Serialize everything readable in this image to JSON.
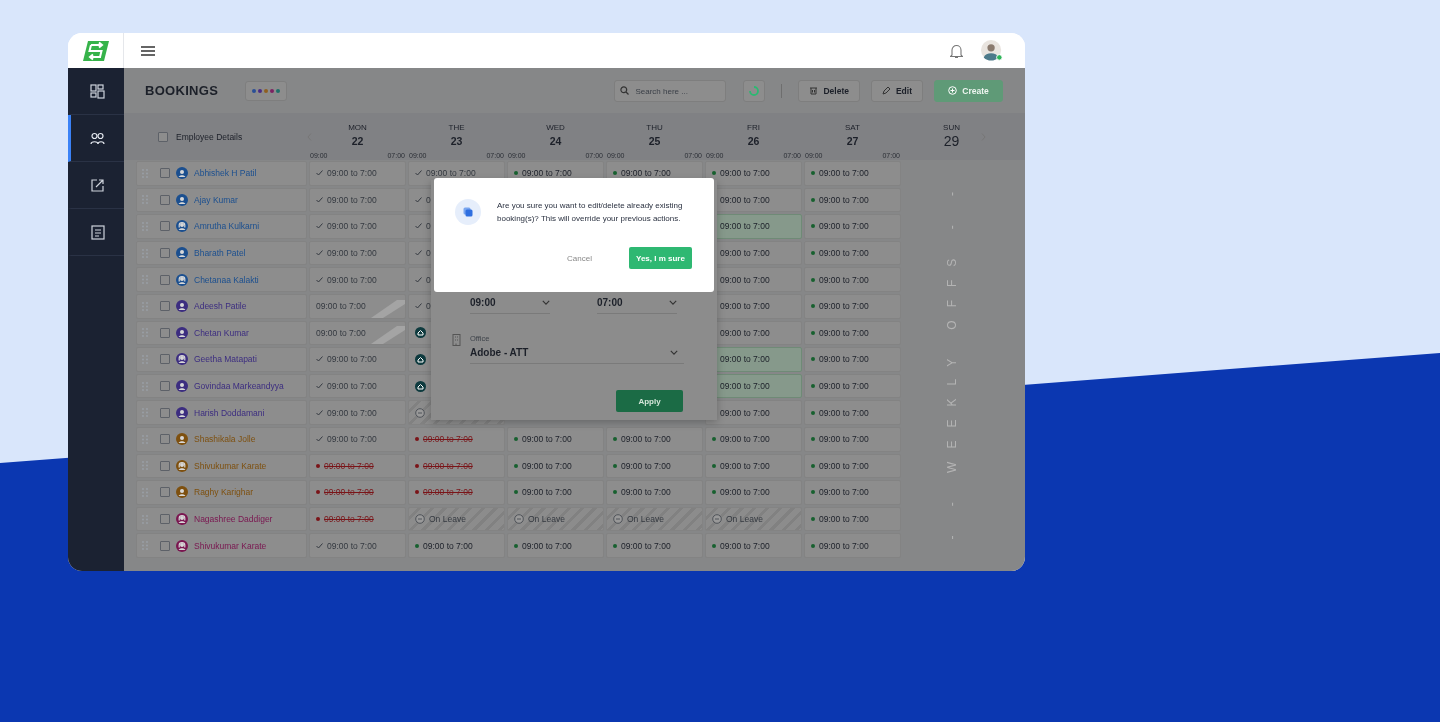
{
  "sidebar": {
    "items": [
      {
        "kind": "dashboard",
        "selected": false
      },
      {
        "kind": "people",
        "selected": true
      },
      {
        "kind": "share",
        "selected": false
      },
      {
        "kind": "document",
        "selected": false
      }
    ]
  },
  "page": {
    "title": "BOOKINGS",
    "legend": [
      {
        "color": "#2a4f96"
      },
      {
        "color": "#4a2c86"
      },
      {
        "color": "#8f5f20"
      },
      {
        "color": "#7c2262"
      },
      {
        "color": "#1e7069"
      }
    ],
    "search": {
      "placeholder": "Search here ..."
    },
    "actions": [
      {
        "kind": "delete",
        "label": "Delete",
        "disabled": false
      },
      {
        "kind": "edit",
        "label": "Edit",
        "disabled": false
      },
      {
        "kind": "create",
        "label": "Create",
        "disabled": true
      }
    ]
  },
  "table": {
    "header": {
      "label": "Employee Details",
      "checked": false
    },
    "days": [
      {
        "day": "MON",
        "date": "22",
        "start": "09:00",
        "end": "07:00"
      },
      {
        "day": "THE",
        "date": "23",
        "start": "09:00",
        "end": "07:00"
      },
      {
        "day": "WED",
        "date": "24",
        "start": "09:00",
        "end": "07:00"
      },
      {
        "day": "THU",
        "date": "25",
        "start": "09:00",
        "end": "07:00"
      },
      {
        "day": "FRI",
        "date": "26",
        "start": "09:00",
        "end": "07:00"
      },
      {
        "day": "SAT",
        "date": "27",
        "start": "09:00",
        "end": "07:00"
      },
      {
        "day": "SUN",
        "date": "29"
      }
    ],
    "weekly_off_label": "- - WEEKLY OFFS - -",
    "rows": [
      {
        "name": "Abhishek H Patil",
        "color": "#1b4f8f",
        "kind": "male",
        "checked": false,
        "cells": [
          {
            "kind": "done",
            "text": "09:00 to 7:00",
            "selected": false
          },
          {
            "kind": "done",
            "text": "09:00 to 7:00",
            "selected": false
          },
          {
            "kind": "booked",
            "text": "09:00 to 7:00",
            "selected": false
          },
          {
            "kind": "booked",
            "text": "09:00 to 7:00",
            "selected": false
          },
          {
            "kind": "booked",
            "text": "09:00 to 7:00",
            "selected": false
          },
          {
            "kind": "booked",
            "text": "09:00 to 7:00",
            "selected": false
          }
        ]
      },
      {
        "name": "Ajay Kumar",
        "color": "#1b4f8f",
        "kind": "male",
        "checked": false,
        "cells": [
          {
            "kind": "done",
            "text": "09:00 to 7:00",
            "selected": false
          },
          {
            "kind": "done",
            "text": "0",
            "selected": false
          },
          null,
          null,
          {
            "kind": "booked",
            "text": "09:00 to 7:00",
            "selected": false
          },
          {
            "kind": "booked",
            "text": "09:00 to 7:00",
            "selected": false
          }
        ]
      },
      {
        "name": "Amrutha Kulkarni",
        "color": "#1b4f8f",
        "kind": "female",
        "checked": false,
        "cells": [
          {
            "kind": "done",
            "text": "09:00 to 7:00",
            "selected": false
          },
          {
            "kind": "done",
            "text": "0",
            "selected": false
          },
          null,
          null,
          {
            "kind": "booked",
            "text": "09:00 to 7:00",
            "selected": true
          },
          {
            "kind": "booked",
            "text": "09:00 to 7:00",
            "selected": false
          }
        ]
      },
      {
        "name": "Bharath Patel",
        "color": "#1b4f8f",
        "kind": "male",
        "checked": false,
        "cells": [
          {
            "kind": "done",
            "text": "09:00 to 7:00",
            "selected": false
          },
          {
            "kind": "done",
            "text": "0",
            "selected": false
          },
          null,
          null,
          {
            "kind": "booked",
            "text": "09:00 to 7:00",
            "selected": false
          },
          {
            "kind": "booked",
            "text": "09:00 to 7:00",
            "selected": false
          }
        ]
      },
      {
        "name": "Chetanaa Kalakti",
        "color": "#1b4f8f",
        "kind": "female",
        "checked": false,
        "cells": [
          {
            "kind": "done",
            "text": "09:00 to 7:00",
            "selected": false
          },
          {
            "kind": "done",
            "text": "0",
            "selected": false
          },
          null,
          null,
          {
            "kind": "booked",
            "text": "09:00 to 7:00",
            "selected": false
          },
          {
            "kind": "booked",
            "text": "09:00 to 7:00",
            "selected": false
          }
        ]
      },
      {
        "name": "Adeesh Patile",
        "color": "#3c2d80",
        "kind": "male",
        "checked": false,
        "cells": [
          {
            "kind": "absent",
            "text": "09:00 to 7:00",
            "selected": false
          },
          {
            "kind": "done",
            "text": "0",
            "selected": false
          },
          null,
          null,
          {
            "kind": "booked",
            "text": "09:00 to 7:00",
            "selected": false
          },
          {
            "kind": "booked",
            "text": "09:00 to 7:00",
            "selected": false
          }
        ]
      },
      {
        "name": "Chetan Kumar",
        "color": "#3c2d80",
        "kind": "male",
        "checked": false,
        "cells": [
          {
            "kind": "absent",
            "text": "09:00 to 7:00",
            "selected": false
          },
          {
            "kind": "icon",
            "selected": false
          },
          null,
          null,
          {
            "kind": "booked",
            "text": "09:00 to 7:00",
            "selected": false
          },
          {
            "kind": "booked",
            "text": "09:00 to 7:00",
            "selected": false
          }
        ]
      },
      {
        "name": "Geetha Matapati",
        "color": "#3c2d80",
        "kind": "female",
        "checked": false,
        "cells": [
          {
            "kind": "done",
            "text": "09:00 to 7:00",
            "selected": false
          },
          {
            "kind": "icon",
            "selected": false
          },
          null,
          null,
          {
            "kind": "booked",
            "text": "09:00 to 7:00",
            "selected": true
          },
          {
            "kind": "booked",
            "text": "09:00 to 7:00",
            "selected": false
          }
        ]
      },
      {
        "name": "Govindaa Markeandyya",
        "color": "#3c2d80",
        "kind": "male",
        "checked": false,
        "cells": [
          {
            "kind": "done",
            "text": "09:00 to 7:00",
            "selected": false
          },
          {
            "kind": "icon",
            "selected": false
          },
          null,
          null,
          {
            "kind": "booked",
            "text": "09:00 to 7:00",
            "selected": true
          },
          {
            "kind": "booked",
            "text": "09:00 to 7:00",
            "selected": false
          }
        ]
      },
      {
        "name": "Harish Doddamani",
        "color": "#3c2d80",
        "kind": "male",
        "checked": false,
        "cells": [
          {
            "kind": "done",
            "text": "09:00 to 7:00",
            "selected": false
          },
          {
            "kind": "leave",
            "selected": false
          },
          null,
          null,
          {
            "kind": "booked",
            "text": "09:00 to 7:00",
            "selected": false
          },
          {
            "kind": "booked",
            "text": "09:00 to 7:00",
            "selected": false
          }
        ]
      },
      {
        "name": "Shashikala Jolle",
        "color": "#7e500f",
        "kind": "male",
        "checked": false,
        "cells": [
          {
            "kind": "done",
            "text": "09:00 to 7:00",
            "selected": false
          },
          {
            "kind": "cancelled",
            "text": "09:00 to 7:00",
            "selected": false
          },
          {
            "kind": "booked",
            "text": "09:00 to 7:00",
            "selected": false
          },
          {
            "kind": "booked",
            "text": "09:00 to 7:00",
            "selected": false
          },
          {
            "kind": "booked",
            "text": "09:00 to 7:00",
            "selected": false
          },
          {
            "kind": "booked",
            "text": "09:00 to 7:00",
            "selected": false
          }
        ]
      },
      {
        "name": "Shivukumar Karate",
        "color": "#7e500f",
        "kind": "female",
        "checked": false,
        "cells": [
          {
            "kind": "cancelled",
            "text": "09:00 to 7:00",
            "selected": false
          },
          {
            "kind": "cancelled",
            "text": "09:00 to 7:00",
            "selected": false
          },
          {
            "kind": "booked",
            "text": "09:00 to 7:00",
            "selected": false
          },
          {
            "kind": "booked",
            "text": "09:00 to 7:00",
            "selected": false
          },
          {
            "kind": "booked",
            "text": "09:00 to 7:00",
            "selected": false
          },
          {
            "kind": "booked",
            "text": "09:00 to 7:00",
            "selected": false
          }
        ]
      },
      {
        "name": "Raghy Karighar",
        "color": "#7e500f",
        "kind": "male",
        "checked": false,
        "cells": [
          {
            "kind": "cancelled",
            "text": "09:00 to 7:00",
            "selected": false
          },
          {
            "kind": "cancelled",
            "text": "09:00 to 7:00",
            "selected": false
          },
          {
            "kind": "booked",
            "text": "09:00 to 7:00",
            "selected": false
          },
          {
            "kind": "booked",
            "text": "09:00 to 7:00",
            "selected": false
          },
          {
            "kind": "booked",
            "text": "09:00 to 7:00",
            "selected": false
          },
          {
            "kind": "booked",
            "text": "09:00 to 7:00",
            "selected": false
          }
        ]
      },
      {
        "name": "Nagashree Daddiger",
        "color": "#7a1650",
        "kind": "female",
        "checked": false,
        "cells": [
          {
            "kind": "cancelled",
            "text": "09:00 to 7:00",
            "selected": false
          },
          {
            "kind": "leave",
            "text": "On Leave",
            "selected": false
          },
          {
            "kind": "leave",
            "text": "On Leave",
            "selected": false
          },
          {
            "kind": "leave",
            "text": "On Leave",
            "selected": false
          },
          {
            "kind": "leave",
            "text": "On Leave",
            "selected": false
          },
          {
            "kind": "booked",
            "text": "09:00 to 7:00",
            "selected": false
          }
        ]
      },
      {
        "name": "Shivukumar Karate",
        "color": "#7a1650",
        "kind": "female",
        "checked": false,
        "cells": [
          {
            "kind": "done",
            "text": "09:00 to 7:00",
            "selected": false
          },
          {
            "kind": "booked",
            "text": "09:00 to 7:00",
            "selected": false
          },
          {
            "kind": "booked",
            "text": "09:00 to 7:00",
            "selected": false
          },
          {
            "kind": "booked",
            "text": "09:00 to 7:00",
            "selected": false
          },
          {
            "kind": "booked",
            "text": "09:00 to 7:00",
            "selected": false
          },
          {
            "kind": "booked",
            "text": "09:00 to 7:00",
            "selected": false
          }
        ]
      }
    ]
  },
  "time_popup": {
    "start": "09:00",
    "end": "07:00",
    "office_label": "Office",
    "office": "Adobe - ATT",
    "apply": "Apply"
  },
  "dialog": {
    "message": "Are you sure you want to edit/delete already existing booking(s)? This will override your previous actions.",
    "cancel": "Cancel",
    "confirm": "Yes, I m sure"
  }
}
